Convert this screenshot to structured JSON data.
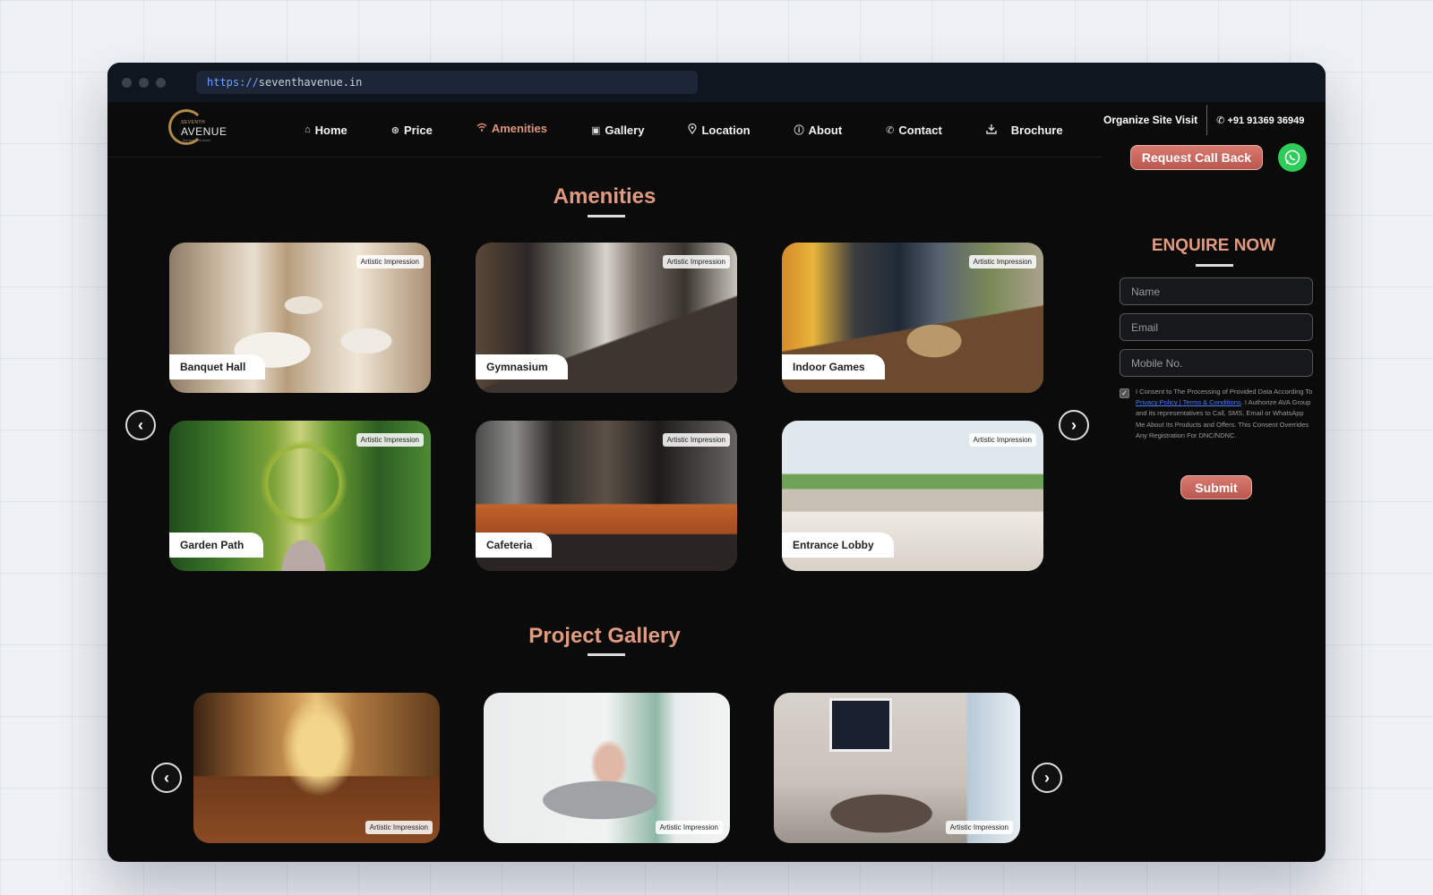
{
  "browser": {
    "url_scheme": "https://",
    "url_host": "seventhavenue.in"
  },
  "logo": {
    "small": "SEVENTH",
    "big": "AVENUE",
    "tag": "live the new level"
  },
  "nav": {
    "items": [
      {
        "label": "Home",
        "icon": "home-icon"
      },
      {
        "label": "Price",
        "icon": "price-icon"
      },
      {
        "label": "Amenities",
        "icon": "wifi-icon",
        "active": true
      },
      {
        "label": "Gallery",
        "icon": "image-icon"
      },
      {
        "label": "Location",
        "icon": "location-pin-icon"
      },
      {
        "label": "About",
        "icon": "info-icon"
      },
      {
        "label": "Contact",
        "icon": "phone-icon"
      },
      {
        "label": "Brochure",
        "icon": "download-icon"
      }
    ],
    "site_visit": "Organize Site Visit",
    "phone": "+91 91369 36949",
    "callback": "Request Call Back"
  },
  "amenities": {
    "title": "Amenities",
    "badge": "Artistic Impression",
    "cards": [
      {
        "label": "Banquet Hall"
      },
      {
        "label": "Gymnasium"
      },
      {
        "label": "Indoor Games"
      },
      {
        "label": "Garden Path"
      },
      {
        "label": "Cafeteria"
      },
      {
        "label": "Entrance Lobby"
      }
    ]
  },
  "gallery": {
    "title": "Project Gallery",
    "badge": "Artistic Impression"
  },
  "enquiry": {
    "title": "ENQUIRE NOW",
    "name_placeholder": "Name",
    "email_placeholder": "Email",
    "mobile_placeholder": "Mobile No.",
    "consent_before": "I Consent to The Processing of Provided Data According To ",
    "consent_link": "Privacy Policy | Terms & Conditions",
    "consent_after": ". I Authorize AVA Group and its representatives to Call, SMS, Email or WhatsApp Me About Its Products and Offers. This Consent Overrides Any Registration For DNC/NDNC.",
    "submit": "Submit"
  },
  "colors": {
    "accent": "#e09a80",
    "button": "#c9665d",
    "whatsapp": "#2ecc59",
    "background": "#0b0b0c"
  }
}
